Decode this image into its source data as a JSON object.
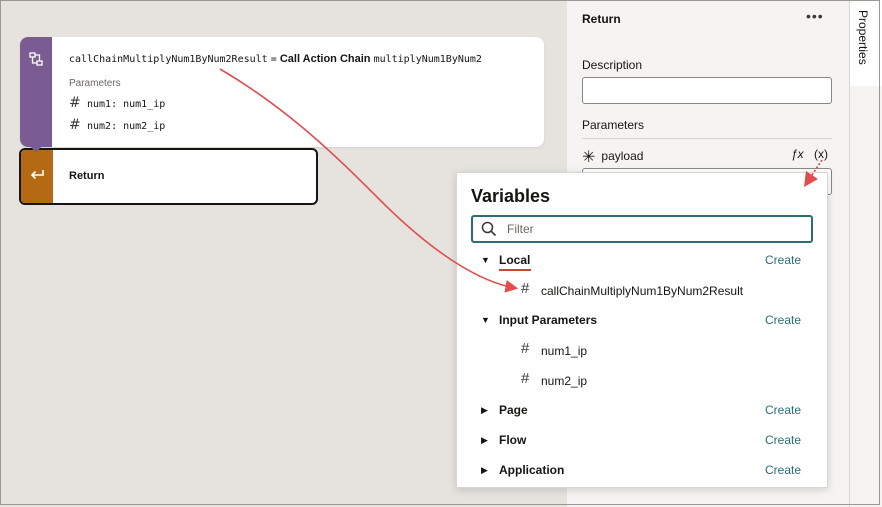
{
  "canvas": {
    "call_node": {
      "result_var": "callChainMultiplyNum1ByNum2Result",
      "equals": "=",
      "action_label": "Call Action Chain",
      "chain_name": "multiplyNum1ByNum2",
      "params_heading": "Parameters",
      "params": [
        {
          "icon": "hash-icon",
          "text": "num1: num1_ip"
        },
        {
          "icon": "hash-icon",
          "text": "num2: num2_ip"
        }
      ],
      "stripe_color": "#7b5c92"
    },
    "return_node": {
      "label": "Return",
      "stripe_color": "#b36a12"
    }
  },
  "properties": {
    "tab_label": "Properties",
    "title": "Return",
    "menu_icon": "more-icon",
    "description_label": "Description",
    "description_value": "",
    "parameters_label": "Parameters",
    "payload_label": "payload",
    "fx_label": "ƒx",
    "var_label": "(x)"
  },
  "variables_popup": {
    "title": "Variables",
    "filter_placeholder": "Filter",
    "create_label": "Create",
    "sections": [
      {
        "label": "Local",
        "expanded": true,
        "items": [
          "callChainMultiplyNum1ByNum2Result"
        ]
      },
      {
        "label": "Input Parameters",
        "expanded": true,
        "items": [
          "num1_ip",
          "num2_ip"
        ]
      },
      {
        "label": "Page",
        "expanded": false,
        "items": []
      },
      {
        "label": "Flow",
        "expanded": false,
        "items": []
      },
      {
        "label": "Application",
        "expanded": false,
        "items": []
      }
    ]
  },
  "colors": {
    "accent": "#2b6d74",
    "annotation": "#e04d4d"
  }
}
